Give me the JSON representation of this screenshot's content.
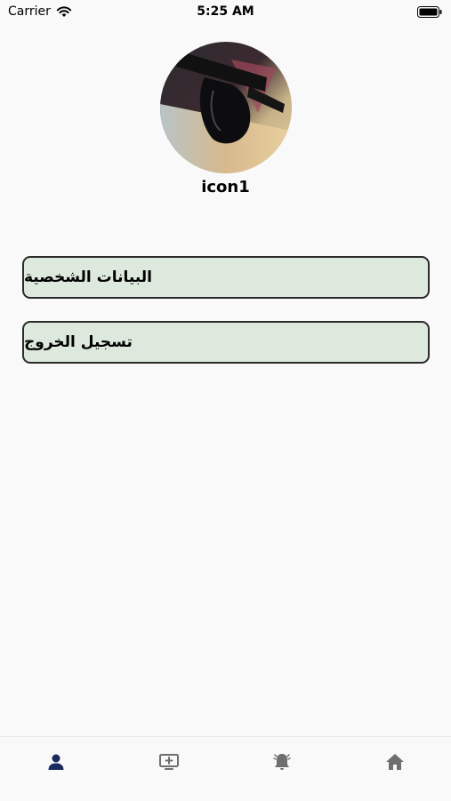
{
  "status_bar": {
    "carrier": "Carrier",
    "time": "5:25 AM"
  },
  "profile": {
    "username": "icon1",
    "avatar_icon": "sunglasses-photo"
  },
  "menu": {
    "personal_data_label": "البيانات الشخصية",
    "logout_label": "تسجيل الخروج"
  },
  "tab_bar": {
    "tabs": [
      {
        "icon": "home-icon",
        "active": false
      },
      {
        "icon": "bell-icon",
        "active": false
      },
      {
        "icon": "add-screen-icon",
        "active": false
      },
      {
        "icon": "person-icon",
        "active": true
      }
    ]
  },
  "colors": {
    "background": "#f9f9f9",
    "button_fill": "#dde9dd",
    "button_border": "#2b2b2b",
    "tab_active": "#1b2a5c",
    "tab_inactive": "#6e6e6e"
  }
}
